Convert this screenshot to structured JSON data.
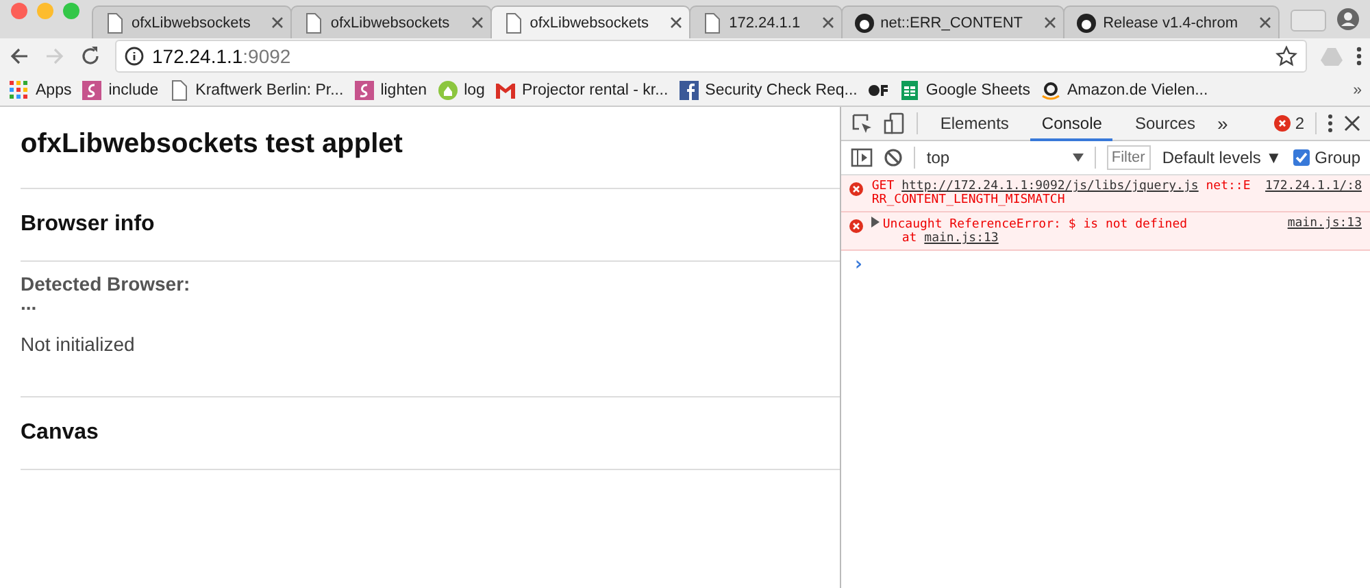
{
  "tabs": [
    {
      "title": "ofxLibwebsockets",
      "kind": "page",
      "selected": false
    },
    {
      "title": "ofxLibwebsockets",
      "kind": "page",
      "selected": false
    },
    {
      "title": "ofxLibwebsockets",
      "kind": "page",
      "selected": true
    },
    {
      "title": "172.24.1.1",
      "kind": "page",
      "selected": false
    },
    {
      "title": "net::ERR_CONTENT",
      "kind": "github",
      "selected": false
    },
    {
      "title": "Release v1.4-chrom",
      "kind": "github",
      "selected": false
    }
  ],
  "address": {
    "host": "172.24.1.1",
    "port": ":9092"
  },
  "bookmarks": [
    {
      "label": "Apps",
      "kind": "apps"
    },
    {
      "label": "include",
      "kind": "pink"
    },
    {
      "label": "Kraftwerk Berlin: Pr...",
      "kind": "page"
    },
    {
      "label": "lighten",
      "kind": "pink"
    },
    {
      "label": "log",
      "kind": "green"
    },
    {
      "label": "Projector rental - kr...",
      "kind": "gmail"
    },
    {
      "label": "Security Check Req...",
      "kind": "facebook"
    },
    {
      "kind": "of"
    },
    {
      "label": "Google Sheets",
      "kind": "sheets"
    },
    {
      "label": "Amazon.de Vielen...",
      "kind": "amazon"
    }
  ],
  "bookmarks_more": "»",
  "page": {
    "title": "ofxLibwebsockets test applet",
    "sections": [
      {
        "heading": "Browser info",
        "lines": [
          {
            "kind": "label",
            "text": "Detected Browser:"
          },
          {
            "kind": "label",
            "text": "..."
          },
          {
            "kind": "text",
            "text": "Not initialized"
          }
        ]
      },
      {
        "heading": "Canvas"
      }
    ]
  },
  "devtools": {
    "tabs": [
      {
        "label": "Elements",
        "selected": false
      },
      {
        "label": "Console",
        "selected": true
      },
      {
        "label": "Sources",
        "selected": false
      }
    ],
    "more": "»",
    "error_count": "2",
    "context": "top",
    "filter_placeholder": "Filter",
    "levels": "Default levels ▼",
    "group": {
      "label": "Group",
      "checked": true
    },
    "messages": [
      {
        "kind": "error",
        "expandable": false,
        "parts": [
          {
            "kind": "text",
            "text": "GET "
          },
          {
            "kind": "link",
            "text": "http://172.24.1.1:9092/js/libs/jquery.js"
          },
          {
            "kind": "text",
            "text": " net::ERR_CONTENT_LENGTH_MISMATCH"
          }
        ],
        "source": "172.24.1.1/:8"
      },
      {
        "kind": "error",
        "expandable": true,
        "parts": [
          {
            "kind": "text",
            "text": "Uncaught ReferenceError: $ is not defined"
          }
        ],
        "source": "main.js:13",
        "trace": [
          {
            "kind": "text",
            "text": "at "
          },
          {
            "kind": "link",
            "text": "main.js:13"
          }
        ]
      }
    ],
    "prompt": "›"
  }
}
